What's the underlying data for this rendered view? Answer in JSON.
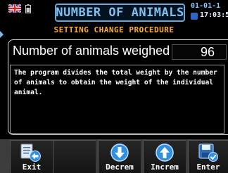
{
  "header": {
    "title": "NUMBER OF ANIMALS",
    "date": "01-01-1",
    "time": "17:03:5",
    "subtitle": "SETTING CHANGE PROCEDURE"
  },
  "parameter": {
    "label": "Number of animals weighed",
    "value": "96"
  },
  "description": "The program divides the total weight by the number of animals to obtain the weight of the individual animal.",
  "toolbar": {
    "keys": [
      {
        "label": "Exit",
        "icon": "exit-icon"
      },
      {
        "label": "",
        "icon": ""
      },
      {
        "label": "Decrem",
        "icon": "decrement-arrow-icon"
      },
      {
        "label": "Increm",
        "icon": "increment-arrow-icon"
      },
      {
        "label": "Enter",
        "icon": "save-icon"
      }
    ]
  },
  "colors": {
    "title": "#7ec0f0",
    "subtitle": "#ffae2e",
    "accent_blue": "#2f8fe0"
  }
}
